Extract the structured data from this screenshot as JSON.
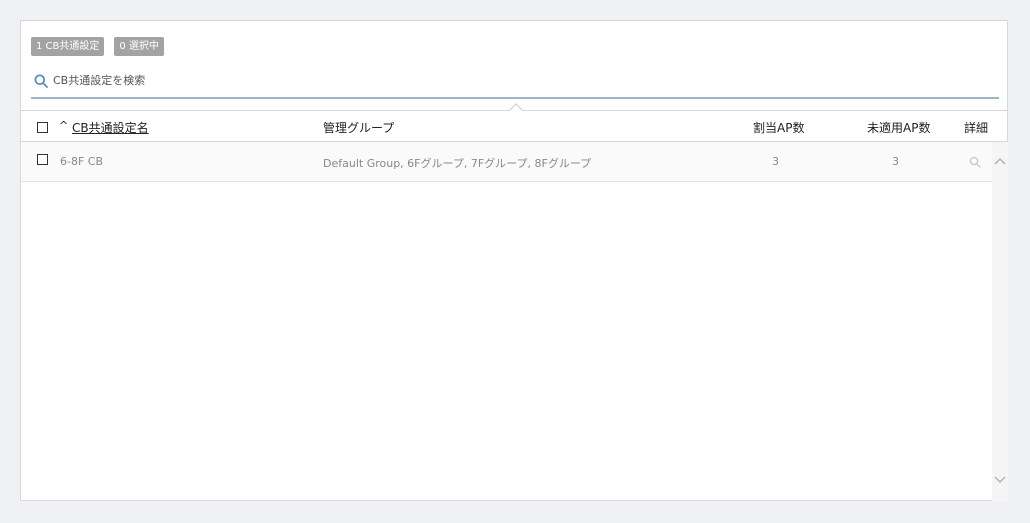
{
  "badges": {
    "count": "1 CB共通設定",
    "selected": "0 選択中"
  },
  "search": {
    "placeholder": "CB共通設定を検索",
    "value": ""
  },
  "table": {
    "sort_indicator": "^",
    "columns": {
      "name": "CB共通設定名",
      "group": "管理グループ",
      "assigned_ap": "割当AP数",
      "unapplied_ap": "未適用AP数",
      "detail": "詳細"
    },
    "rows": [
      {
        "name": "6-8F CB",
        "group": "Default Group, 6Fグループ, 7Fグループ, 8Fグループ",
        "assigned_ap": "3",
        "unapplied_ap": "3"
      }
    ]
  },
  "colors": {
    "badge_bg": "#a3a3a3",
    "search_underline": "#9fb6c8",
    "search_icon": "#5a8fb8",
    "page_bg": "#f0f1f4"
  },
  "icons": {
    "search": "search-icon",
    "detail": "magnifier-icon",
    "scroll_up": "chevron-up-icon",
    "scroll_down": "chevron-down-icon"
  }
}
